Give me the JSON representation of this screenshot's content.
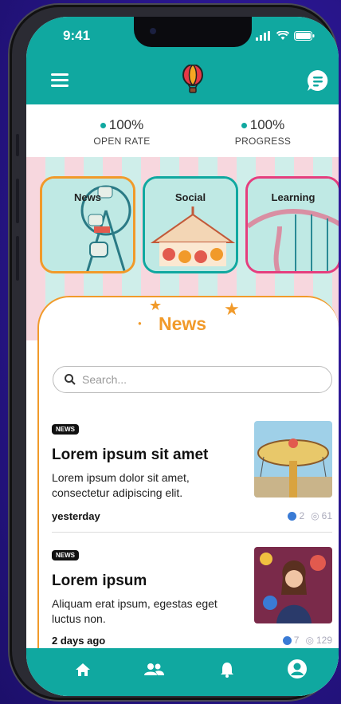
{
  "status": {
    "time": "9:41"
  },
  "stats": [
    {
      "value": "100%",
      "label": "OPEN RATE"
    },
    {
      "value": "100%",
      "label": "PROGRESS"
    }
  ],
  "categories": [
    {
      "label": "News",
      "color": "#f19a2a"
    },
    {
      "label": "Social",
      "color": "#10a8a0"
    },
    {
      "label": "Learning",
      "color": "#e53e7e"
    }
  ],
  "section": {
    "title": "News"
  },
  "search": {
    "placeholder": "Search..."
  },
  "articles": [
    {
      "badge": "NEWS",
      "title": "Lorem ipsum sit amet",
      "body": "Lorem ipsum dolor sit amet, consectetur adipiscing elit.",
      "date": "yesterday",
      "likes": "2",
      "views": "61"
    },
    {
      "badge": "NEWS",
      "title": "Lorem ipsum",
      "body": "Aliquam erat ipsum, egestas eget luctus non.",
      "date": "2 days ago",
      "likes": "7",
      "views": "129"
    }
  ],
  "nav": [
    "home-icon",
    "group-icon",
    "bell-icon",
    "profile-icon"
  ],
  "colors": {
    "teal": "#10a8a0",
    "orange": "#f19a2a",
    "pink": "#e53e7e"
  }
}
